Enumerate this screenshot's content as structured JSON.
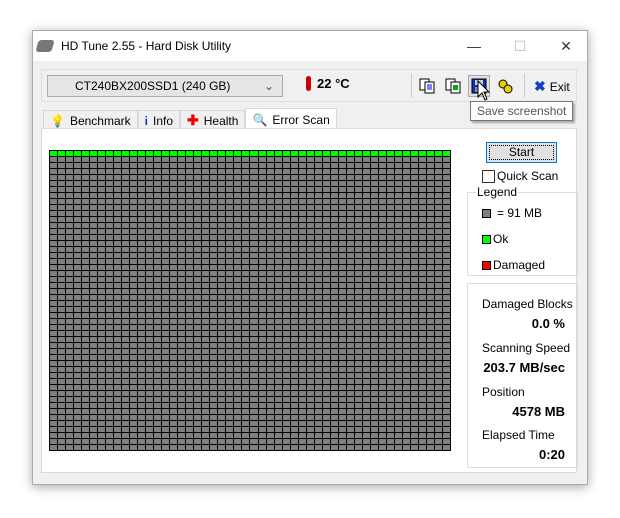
{
  "window": {
    "title": "HD Tune 2.55 - Hard Disk Utility",
    "minimize": "—",
    "maximize": "☐",
    "close": "✕"
  },
  "toolbar": {
    "drive": "CT240BX200SSD1 (240 GB)",
    "temperature": "22 °C",
    "exit_label": "Exit",
    "tooltip": "Save screenshot",
    "tools": [
      "copy-text-icon",
      "copy-image-icon",
      "save-screenshot-icon",
      "options-icon"
    ]
  },
  "tabs": [
    {
      "label": "Benchmark"
    },
    {
      "label": "Info"
    },
    {
      "label": "Health"
    },
    {
      "label": "Error Scan"
    }
  ],
  "scan": {
    "start_label": "Start",
    "quick_scan_label": "Quick Scan",
    "quick_scan_checked": false,
    "rows": 50,
    "cols": 50,
    "ok_rows": 1
  },
  "legend": {
    "title": "Legend",
    "block": "= 91 MB",
    "ok": "Ok",
    "damaged": "Damaged"
  },
  "colors": {
    "ok": "#00ff00",
    "damaged": "#ff0000",
    "block": "#808080"
  },
  "stats": {
    "damaged_label": "Damaged Blocks",
    "damaged_value": "0.0 %",
    "speed_label": "Scanning Speed",
    "speed_value": "203.7 MB/sec",
    "position_label": "Position",
    "position_value": "4578 MB",
    "elapsed_label": "Elapsed Time",
    "elapsed_value": "0:20"
  }
}
